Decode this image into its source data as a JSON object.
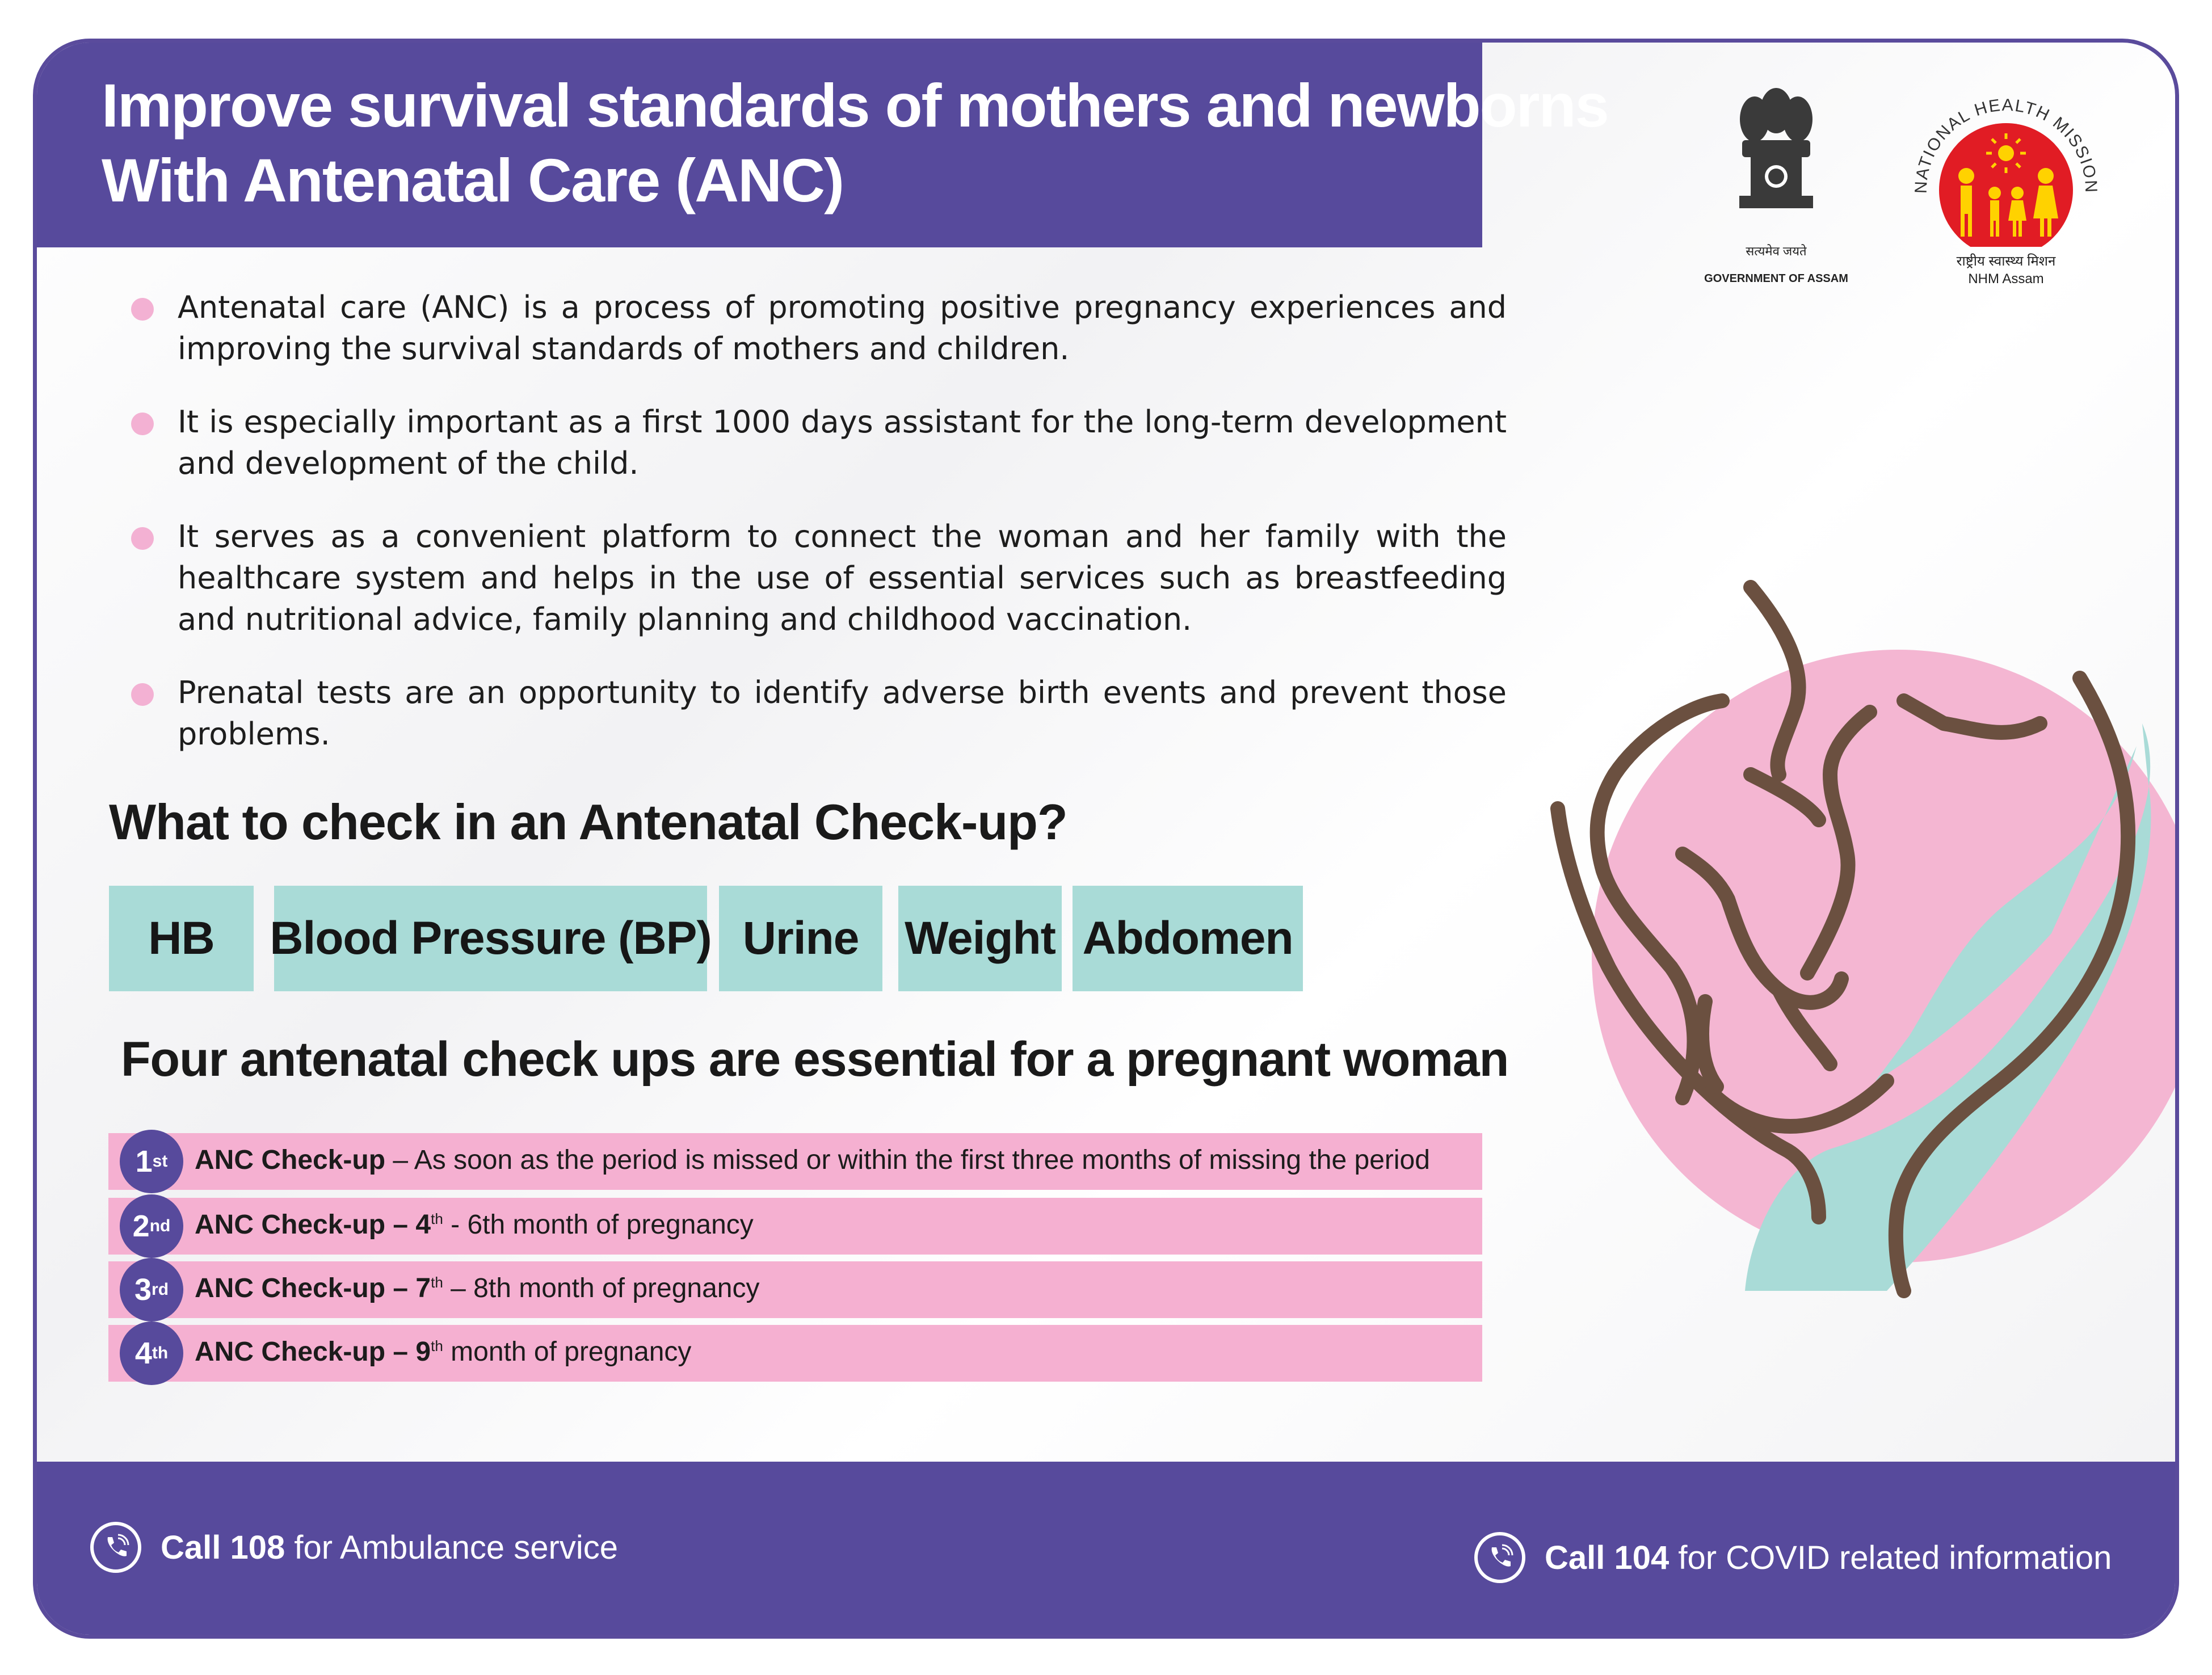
{
  "title": {
    "line1": "Improve survival standards of mothers and newborns",
    "line2": "With Antenatal Care (ANC)"
  },
  "logos": {
    "gov_motto": "सत्यमेव जयते",
    "gov_caption": "GOVERNMENT OF ASSAM",
    "nhm_ring": "NATIONAL HEALTH MISSION",
    "nhm_hindi": "राष्ट्रीय स्वास्थ्य मिशन",
    "nhm_caption": "NHM Assam"
  },
  "bullets": [
    "Antenatal care (ANC) is a process of promoting positive pregnancy experiences and improving the survival standards of mothers and children.",
    "It is especially important as a first 1000 days assistant for the long-term development and development of the child.",
    "It serves as a convenient platform to connect the woman and her family with the healthcare system and helps in the use of essential services such as breastfeeding and nutritional advice, family planning and childhood vaccination.",
    "Prenatal tests are an opportunity to identify adverse birth events and prevent those problems."
  ],
  "checkup": {
    "heading": "What to check in an Antenatal Check-up?",
    "items": [
      "HB",
      "Blood Pressure (BP)",
      "Urine",
      "Weight",
      "Abdomen"
    ]
  },
  "four": {
    "heading": "Four antenatal check ups are essential for a pregnant woman",
    "rows": [
      {
        "num": "1",
        "sup": "st",
        "label": "ANC Check-up",
        "sep": " – ",
        "bold_extra": "",
        "bold_sup": "",
        "rest": "As soon as the period is missed or within the first three months of missing the period"
      },
      {
        "num": "2",
        "sup": "nd",
        "label": "ANC Check-up",
        "sep": " – ",
        "bold_extra": "4",
        "bold_sup": "th",
        "rest": " - 6th month of pregnancy"
      },
      {
        "num": "3",
        "sup": "rd",
        "label": "ANC Check-up",
        "sep": " – ",
        "bold_extra": "7",
        "bold_sup": "th",
        "rest": " – 8th month of pregnancy"
      },
      {
        "num": "4",
        "sup": "th",
        "label": "ANC Check-up",
        "sep": " – ",
        "bold_extra": "9",
        "bold_sup": "th",
        "rest": " month of pregnancy"
      }
    ]
  },
  "footer": {
    "left_bold": "Call 108",
    "left_rest": " for Ambulance service",
    "right_bold": "Call 104",
    "right_rest": " for COVID related information"
  },
  "colors": {
    "purple": "#574a9c",
    "pink": "#f5b0d1",
    "teal": "#a9dbd7",
    "brown": "#6b5040",
    "red": "#e11c24",
    "yellow": "#ffd200"
  }
}
